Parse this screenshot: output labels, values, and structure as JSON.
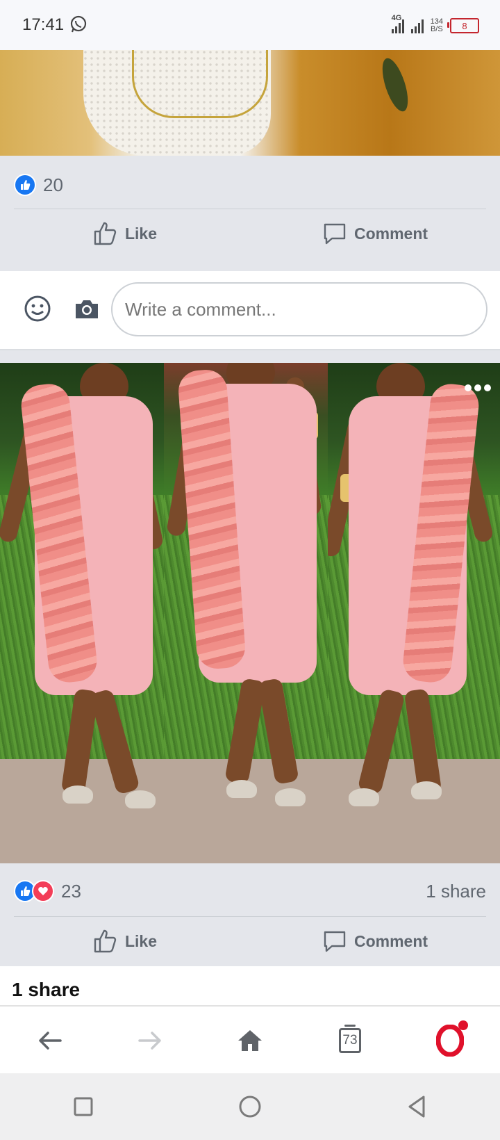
{
  "status_bar": {
    "time": "17:41",
    "network_type": "4G",
    "speed_value": "134",
    "speed_unit": "B/S",
    "battery_level": "8"
  },
  "post1": {
    "reaction_count": "20",
    "like_label": "Like",
    "comment_label": "Comment"
  },
  "composer": {
    "placeholder": "Write a comment..."
  },
  "post2": {
    "reaction_count": "23",
    "share_count_label": "1 share",
    "like_label": "Like",
    "comment_label": "Comment"
  },
  "shares_panel": {
    "title": "1 share"
  },
  "browser_bar": {
    "tabs_count": "73"
  },
  "colors": {
    "facebook_blue": "#1877f2",
    "love_red": "#f33e58",
    "opera_red": "#e0112b",
    "footer_gray": "#e4e6eb"
  },
  "icons": [
    "whatsapp-icon",
    "signal-icon",
    "battery-icon",
    "like-reaction-icon",
    "love-reaction-icon",
    "thumbs-up-icon",
    "comment-bubble-icon",
    "emoji-icon",
    "camera-icon",
    "more-options-icon",
    "back-arrow-icon",
    "forward-arrow-icon",
    "home-icon",
    "tabs-icon",
    "opera-icon",
    "recents-icon",
    "home-circle-icon",
    "back-triangle-icon"
  ]
}
